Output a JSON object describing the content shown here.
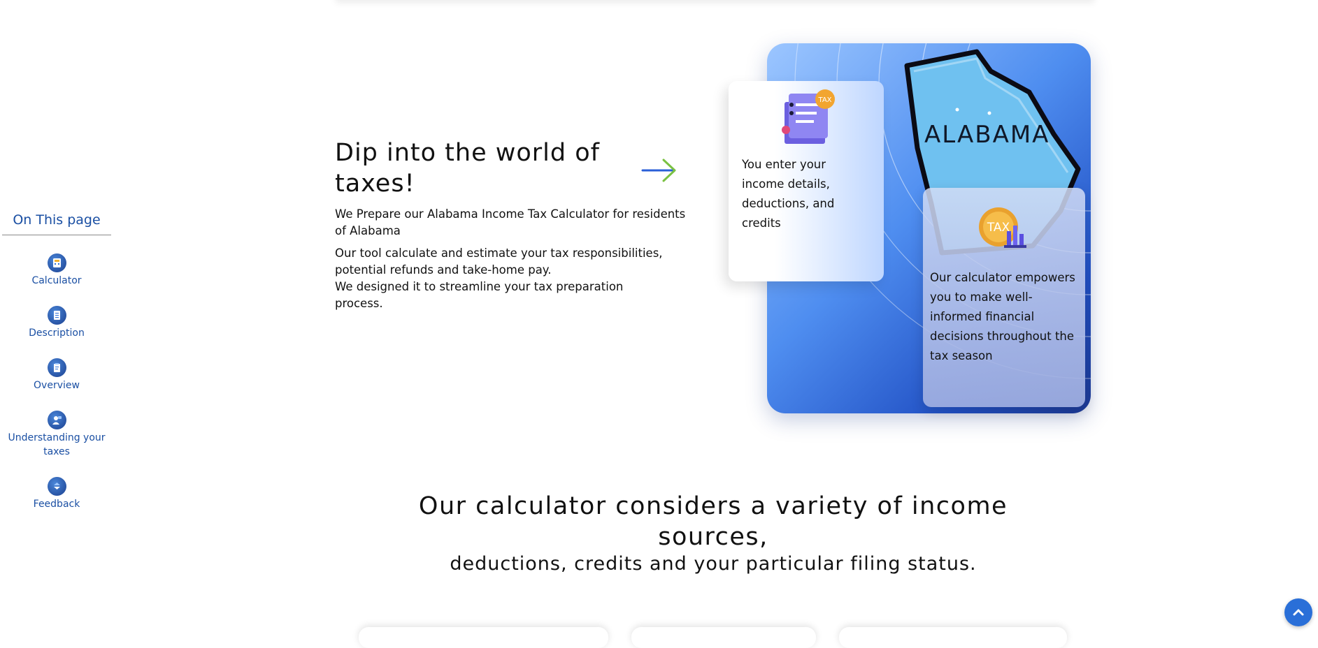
{
  "sidebar": {
    "title": "On This page",
    "items": [
      {
        "label": "Calculator",
        "icon": "calculator-icon"
      },
      {
        "label": "Description",
        "icon": "document-icon"
      },
      {
        "label": "Overview",
        "icon": "clipboard-icon"
      },
      {
        "label": "Understanding your taxes",
        "icon": "person-icon"
      },
      {
        "label": "Feedback",
        "icon": "feedback-icon"
      }
    ]
  },
  "hero": {
    "title": "Dip into the world of taxes!",
    "intro": "We Prepare our Alabama Income Tax Calculator for residents of Alabama",
    "body_line1": "Our tool calculate and estimate your tax responsibilities, potential refunds and take-home pay.",
    "body_line2": "We designed it to streamline your tax preparation process."
  },
  "illustration": {
    "state_name": "ALABAMA",
    "tax_badge_text": "TAX",
    "card_left_text": "You enter your income details, deductions, and credits",
    "card_right_text": "Our calculator empowers you to make well-informed financial decisions throughout the tax season"
  },
  "section": {
    "title": "Our calculator considers a variety of income sources,",
    "subtitle": "deductions, credits and your particular filing status."
  },
  "colors": {
    "accent_blue": "#1a4fa3",
    "card_blue": "#4f8ef0",
    "scroll_button": "#2a6fd8",
    "arrow_green": "#7ac142"
  }
}
